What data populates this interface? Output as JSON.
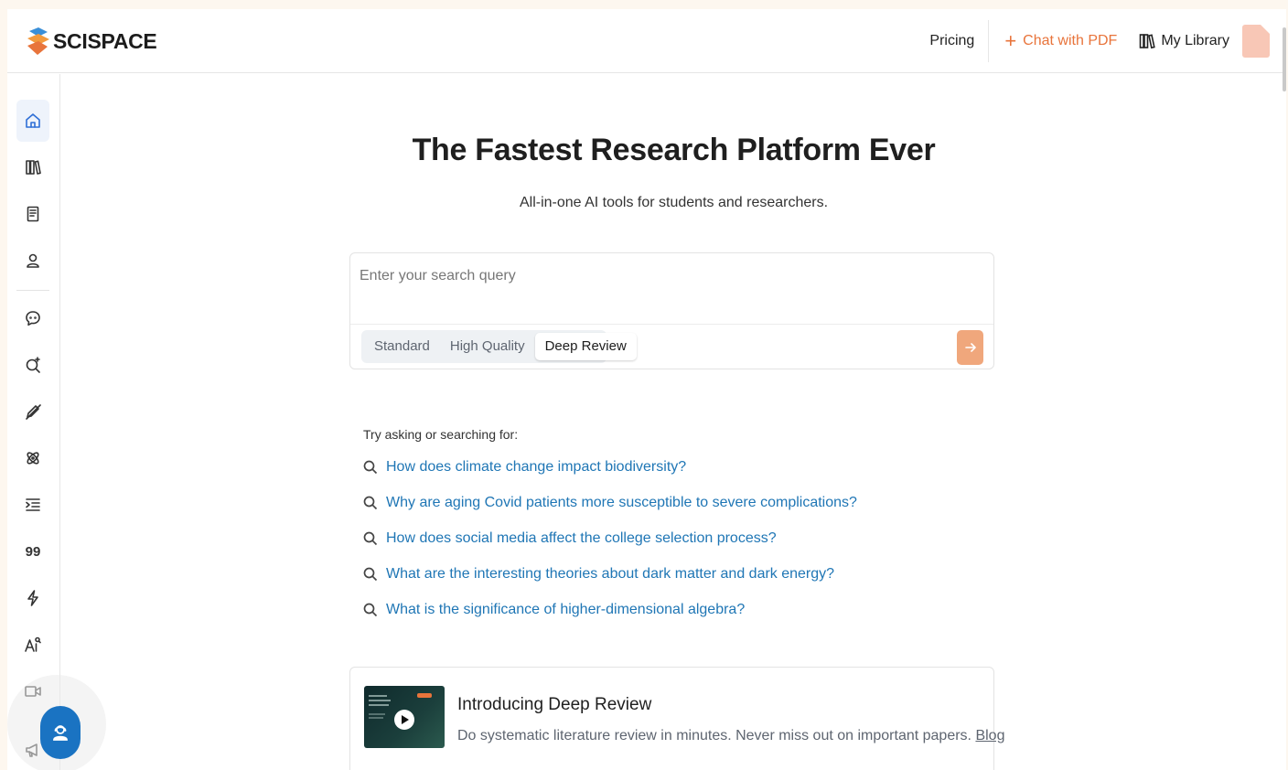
{
  "header": {
    "logo_text": "SCISPACE",
    "nav": {
      "pricing": "Pricing",
      "chat_with_pdf": "Chat with PDF",
      "my_library": "My Library"
    }
  },
  "sidebar": {
    "items": [
      {
        "name": "home",
        "icon": "home-icon",
        "active": true
      },
      {
        "name": "library",
        "icon": "library-icon"
      },
      {
        "name": "notebook",
        "icon": "notebook-icon"
      },
      {
        "name": "profile",
        "icon": "user-icon"
      },
      {
        "name": "chat",
        "icon": "chat-bubble-icon"
      },
      {
        "name": "search-papers",
        "icon": "search-sparkle-icon"
      },
      {
        "name": "writer",
        "icon": "pen-icon"
      },
      {
        "name": "extract",
        "icon": "atom-icon"
      },
      {
        "name": "paraphraser",
        "icon": "indent-list-icon"
      },
      {
        "name": "citation",
        "icon": "quote-icon",
        "text": "99"
      },
      {
        "name": "quick-actions",
        "icon": "lightning-icon"
      },
      {
        "name": "ai-detector",
        "icon": "ai-detector-icon"
      },
      {
        "name": "video",
        "icon": "video-icon"
      },
      {
        "name": "announcements",
        "icon": "megaphone-icon"
      }
    ]
  },
  "hero": {
    "title": "The Fastest Research Platform Ever",
    "subtitle": "All-in-one AI tools for students and researchers."
  },
  "search": {
    "placeholder": "Enter your search query",
    "value": "",
    "modes": [
      "Standard",
      "High Quality",
      "Deep Review"
    ],
    "selected_mode": "Deep Review"
  },
  "suggestions": {
    "label": "Try asking or searching for:",
    "items": [
      "How does climate change impact biodiversity?",
      "Why are aging Covid patients more susceptible to severe complications?",
      "How does social media affect the college selection process?",
      "What are the interesting theories about dark matter and dark energy?",
      "What is the significance of higher-dimensional algebra?"
    ]
  },
  "promo": {
    "title": "Introducing Deep Review",
    "description": "Do systematic literature review in minutes. Never miss out on important papers.",
    "link": "Blog"
  },
  "colors": {
    "accent_orange": "#e8743b",
    "submit_button": "#f0a77c",
    "link_blue": "#1f76b5",
    "help_button": "#1a73c2"
  }
}
